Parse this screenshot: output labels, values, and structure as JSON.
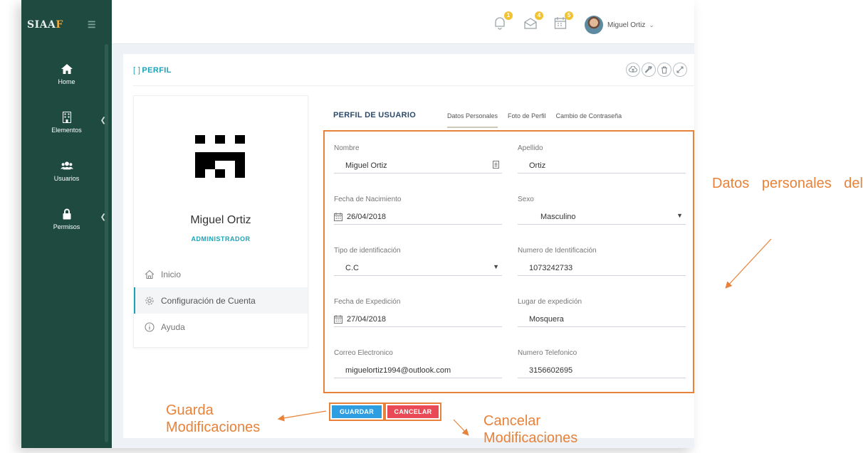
{
  "app": {
    "brand_main": "SIAA",
    "brand_accent": "F"
  },
  "sidebar": {
    "items": [
      {
        "label": "Home",
        "icon": "home-icon",
        "has_caret": false
      },
      {
        "label": "Elementos",
        "icon": "building-icon",
        "has_caret": true
      },
      {
        "label": "Usuarios",
        "icon": "users-icon",
        "has_caret": false
      },
      {
        "label": "Permisos",
        "icon": "lock-icon",
        "has_caret": true
      }
    ]
  },
  "topbar": {
    "notifications": [
      {
        "icon": "bell-icon",
        "count": "1"
      },
      {
        "icon": "envelope-icon",
        "count": "4"
      },
      {
        "icon": "calendar-icon",
        "count": "5"
      }
    ],
    "user_name": "Miguel Ortiz"
  },
  "panel": {
    "title": "PERFIL"
  },
  "profile": {
    "name": "Miguel Ortiz",
    "role": "ADMINISTRADOR",
    "menu": [
      {
        "label": "Inicio",
        "icon": "home-outline-icon",
        "active": false
      },
      {
        "label": "Configuración de Cuenta",
        "icon": "gear-icon",
        "active": true
      },
      {
        "label": "Ayuda",
        "icon": "info-icon",
        "active": false
      }
    ]
  },
  "form": {
    "heading": "PERFIL DE USUARIO",
    "tabs": [
      "Datos Personales",
      "Foto de Perfil",
      "Cambio de Contraseña"
    ],
    "active_tab": "Datos Personales",
    "fields": {
      "nombre": {
        "label": "Nombre",
        "value": "Miguel Ortiz"
      },
      "apellido": {
        "label": "Apellido",
        "value": "Ortiz"
      },
      "fecha_nacimiento": {
        "label": "Fecha de Nacimiento",
        "value": "26/04/2018"
      },
      "sexo": {
        "label": "Sexo",
        "value": "Masculino"
      },
      "tipo_identificacion": {
        "label": "Tipo de identificación",
        "value": "C.C"
      },
      "numero_identificacion": {
        "label": "Numero de Identificación",
        "value": "1073242733"
      },
      "fecha_expedicion": {
        "label": "Fecha de Expedición",
        "value": "27/04/2018"
      },
      "lugar_expedicion": {
        "label": "Lugar de expedición",
        "value": "Mosquera"
      },
      "correo": {
        "label": "Correo Electronico",
        "value": "miguelortiz1994@outlook.com"
      },
      "telefono": {
        "label": "Numero Telefonico",
        "value": "3156602695"
      }
    },
    "save_label": "GUARDAR",
    "cancel_label": "CANCELAR"
  },
  "annotations": {
    "datos": "Datos personales del",
    "guarda_1": "Guarda",
    "guarda_2": "Modificaciones",
    "cancelar_1": "Cancelar",
    "cancelar_2": "Modificaciones"
  },
  "colors": {
    "sidebar": "#1f4a3f",
    "accent_teal": "#1aa3b8",
    "annotation_orange": "#e8823a",
    "save_blue": "#2e9ee0",
    "cancel_red": "#e94a55"
  }
}
